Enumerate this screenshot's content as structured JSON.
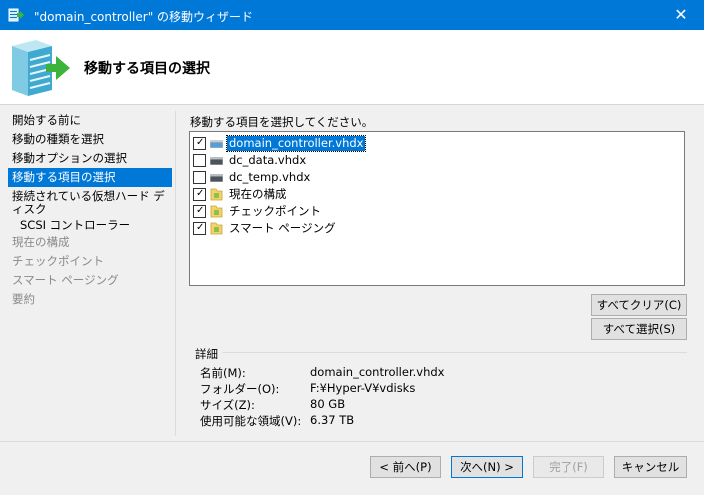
{
  "window": {
    "title": "\"domain_controller\" の移動ウィザード",
    "close_glyph": "✕"
  },
  "header": {
    "title": "移動する項目の選択"
  },
  "steps": [
    {
      "label": "開始する前に",
      "state": "normal"
    },
    {
      "label": "移動の種類を選択",
      "state": "normal"
    },
    {
      "label": "移動オプションの選択",
      "state": "normal"
    },
    {
      "label": "移動する項目の選択",
      "state": "active"
    },
    {
      "label": "接続されている仮想ハード ディスク",
      "state": "normal"
    },
    {
      "label": "SCSI コントローラー",
      "state": "normal"
    },
    {
      "label": "現在の構成",
      "state": "disabled"
    },
    {
      "label": "チェックポイント",
      "state": "disabled"
    },
    {
      "label": "スマート ページング",
      "state": "disabled"
    },
    {
      "label": "要約",
      "state": "disabled"
    }
  ],
  "main": {
    "instruction": "移動する項目を選択してください。",
    "items": [
      {
        "label": "domain_controller.vhdx",
        "checked": true,
        "icon": "disk-icon",
        "selected": true
      },
      {
        "label": "dc_data.vhdx",
        "checked": false,
        "icon": "disk-icon",
        "selected": false
      },
      {
        "label": "dc_temp.vhdx",
        "checked": false,
        "icon": "disk-icon",
        "selected": false
      },
      {
        "label": "現在の構成",
        "checked": true,
        "icon": "folder-icon",
        "selected": false
      },
      {
        "label": "チェックポイント",
        "checked": true,
        "icon": "folder-icon",
        "selected": false
      },
      {
        "label": "スマート ページング",
        "checked": true,
        "icon": "folder-icon",
        "selected": false
      }
    ],
    "clear_all_label": "すべてクリア(C)",
    "select_all_label": "すべて選択(S)"
  },
  "details": {
    "heading": "詳細",
    "rows": [
      {
        "label": "名前(M):",
        "value": "domain_controller.vhdx"
      },
      {
        "label": "フォルダー(O):",
        "value": "F:¥Hyper-V¥vdisks"
      },
      {
        "label": "サイズ(Z):",
        "value": "80 GB"
      },
      {
        "label": "使用可能な領域(V):",
        "value": "6.37 TB"
      }
    ]
  },
  "footer": {
    "back_label": "< 前へ(P)",
    "next_label": "次へ(N) >",
    "finish_label": "完了(F)",
    "cancel_label": "キャンセル"
  },
  "colors": {
    "accent": "#0078d7",
    "arrow": "#3cb43c"
  }
}
